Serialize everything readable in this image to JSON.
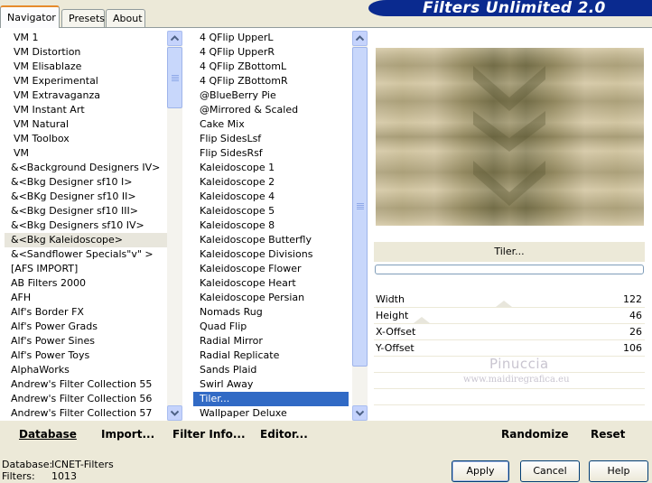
{
  "tabs": {
    "navigator": "Navigator",
    "presets": "Presets",
    "about": "About"
  },
  "banner": {
    "title": "Filters Unlimited 2.0"
  },
  "categories": [
    "VM 1",
    "VM Distortion",
    "VM Elisablaze",
    "VM Experimental",
    "VM Extravaganza",
    "VM Instant Art",
    "VM Natural",
    "VM Toolbox",
    "VM",
    "&<Background Designers IV>",
    "&<Bkg Designer sf10 I>",
    "&<BKg Designer sf10 II>",
    "&<Bkg Designer sf10 III>",
    "&<Bkg Designers sf10 IV>",
    "&<Bkg Kaleidoscope>",
    "&<Sandflower Specials\"v\" >",
    "[AFS IMPORT]",
    "AB Filters 2000",
    "AFH",
    "Alf's Border FX",
    "Alf's Power Grads",
    "Alf's Power Sines",
    "Alf's Power Toys",
    "AlphaWorks",
    "Andrew's Filter Collection 55",
    "Andrew's Filter Collection 56",
    "Andrew's Filter Collection 57"
  ],
  "filters": [
    "4 QFlip UpperL",
    "4 QFlip UpperR",
    "4 QFlip ZBottomL",
    "4 QFlip ZBottomR",
    "@BlueBerry Pie",
    "@Mirrored & Scaled",
    "Cake Mix",
    "Flip SidesLsf",
    "Flip SidesRsf",
    "Kaleidoscope 1",
    "Kaleidoscope 2",
    "Kaleidoscope 4",
    "Kaleidoscope 5",
    "Kaleidoscope 8",
    "Kaleidoscope Butterfly",
    "Kaleidoscope Divisions",
    "Kaleidoscope Flower",
    "Kaleidoscope Heart",
    "Kaleidoscope Persian",
    "Nomads Rug",
    "Quad Flip",
    "Radial Mirror",
    "Radial Replicate",
    "Sands Plaid",
    "Swirl Away",
    "Tiler...",
    "Wallpaper Deluxe"
  ],
  "selected_category": "&<Bkg Kaleidoscope>",
  "selected_filter": "Tiler...",
  "preview": {
    "filter_name": "Tiler..."
  },
  "params": [
    {
      "label": "Width",
      "value": "122"
    },
    {
      "label": "Height",
      "value": "46"
    },
    {
      "label": "X-Offset",
      "value": "26"
    },
    {
      "label": "Y-Offset",
      "value": "106"
    }
  ],
  "watermark": {
    "line1": "Pinuccia",
    "line2": "www.maidiregrafica.eu"
  },
  "toolbar": {
    "database": "Database",
    "import": "Import...",
    "filter_info": "Filter Info...",
    "editor": "Editor...",
    "randomize": "Randomize",
    "reset": "Reset"
  },
  "status": {
    "database_label": "Database:",
    "database_value": "ICNET-Filters",
    "filters_label": "Filters:",
    "filters_value": "1013"
  },
  "buttons": {
    "apply": "Apply",
    "cancel": "Cancel",
    "help": "Help"
  },
  "colors": {
    "banner": "#0a2a8f",
    "selection": "#316ac5",
    "tab_accent": "#e68b2c",
    "pattern_light": "#cfc3a2",
    "pattern_dark": "#7d7650"
  }
}
